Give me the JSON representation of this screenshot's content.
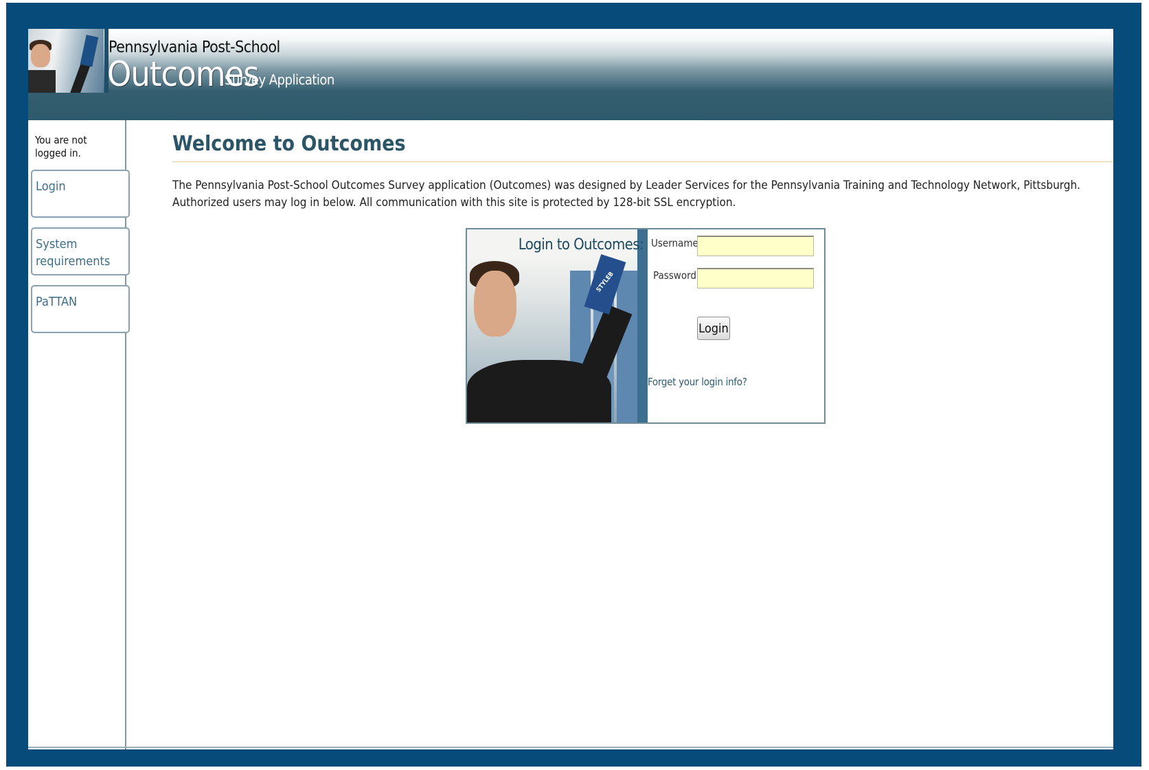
{
  "header": {
    "brand_line1": "Pennsylvania Post-School",
    "brand_big": "Outcomes",
    "brand_small": "Survey Application"
  },
  "sidebar": {
    "status": "You are not logged in.",
    "items": [
      {
        "label": "Login"
      },
      {
        "label": "System requirements"
      },
      {
        "label": "PaTTAN"
      }
    ]
  },
  "main": {
    "title": "Welcome to Outcomes",
    "intro": "The Pennsylvania Post-School Outcomes Survey application (Outcomes) was designed by Leader Services for the Pennsylvania Training and Technology Network, Pittsburgh. Authorized users may log in below. All communication with this site is protected by 128-bit SSL encryption."
  },
  "login": {
    "heading": "Login to Outcomes:",
    "book_text": "STYLEB",
    "username_label": "Username:",
    "password_label": "Password:",
    "username_value": "",
    "password_value": "",
    "button_label": "Login",
    "forgot_link": "Forget your login info?"
  },
  "colors": {
    "frame": "#064b7a",
    "header_dark": "#2d5a6c",
    "title": "#2c5568",
    "link": "#3e6f86",
    "input_bg": "#ffffc9"
  }
}
